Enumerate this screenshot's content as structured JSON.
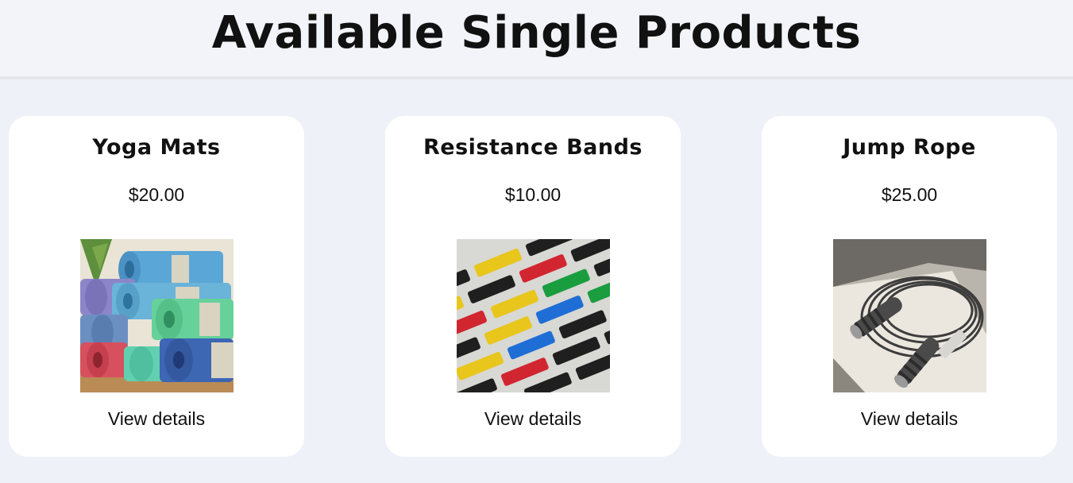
{
  "header": {
    "title": "Available Single Products"
  },
  "products": [
    {
      "name": "Yoga Mats",
      "price": "$20.00",
      "link_label": "View details",
      "image_icon": "yoga-mats-image"
    },
    {
      "name": "Resistance Bands",
      "price": "$10.00",
      "link_label": "View details",
      "image_icon": "resistance-bands-image"
    },
    {
      "name": "Jump Rope",
      "price": "$25.00",
      "link_label": "View details",
      "image_icon": "jump-rope-image"
    }
  ],
  "colors": {
    "background": "#eef1f8",
    "card": "#ffffff",
    "text": "#111111"
  }
}
